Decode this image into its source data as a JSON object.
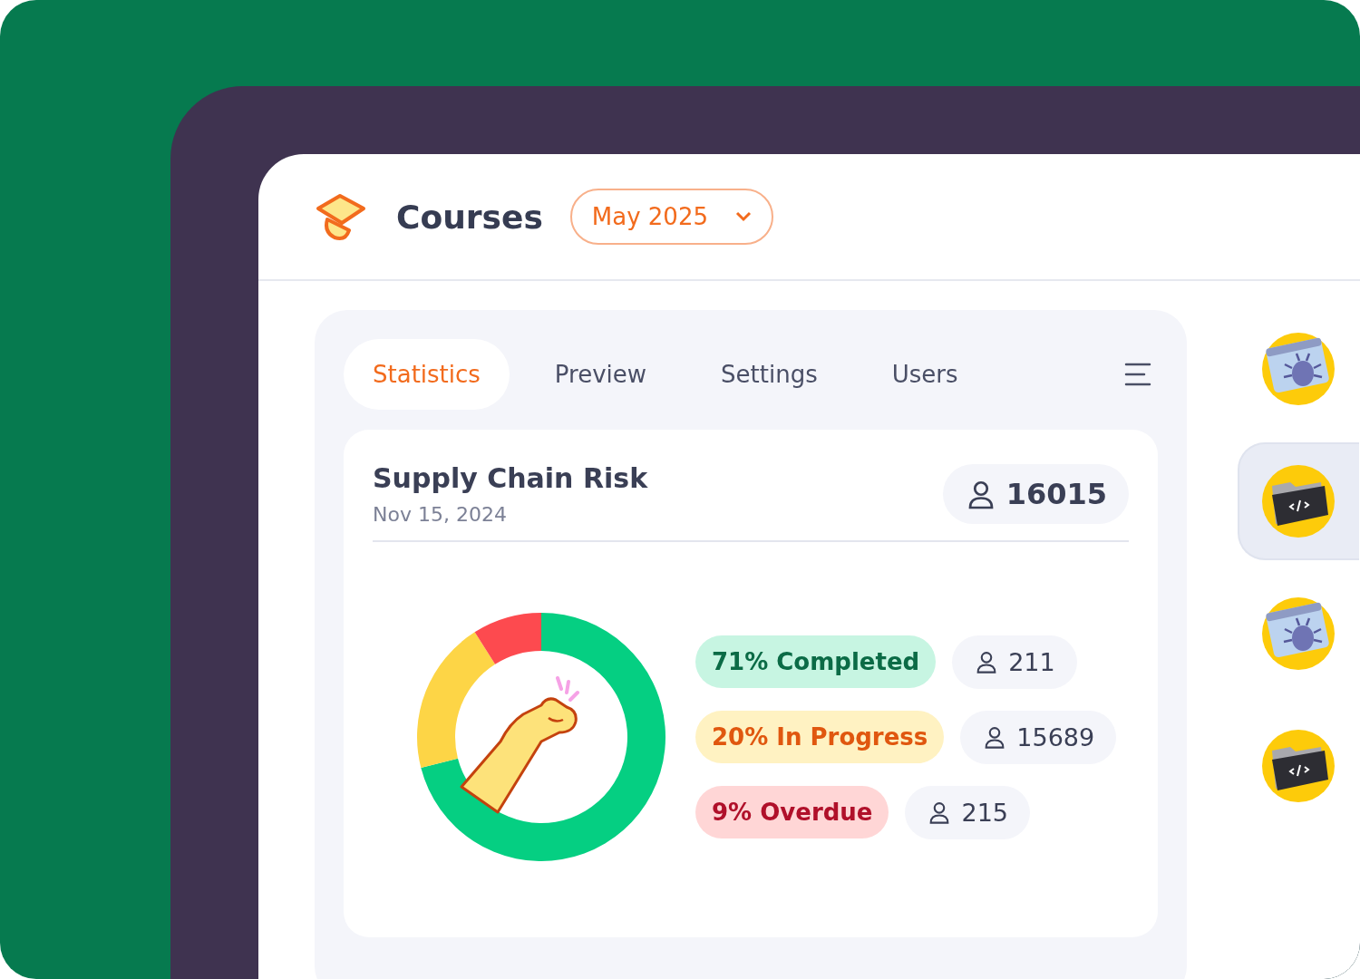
{
  "header": {
    "title": "Courses",
    "month_picker": {
      "value": "May 2025"
    }
  },
  "tabs": [
    {
      "label": "Statistics",
      "selected": true
    },
    {
      "label": "Preview",
      "selected": false
    },
    {
      "label": "Settings",
      "selected": false
    },
    {
      "label": "Users",
      "selected": false
    }
  ],
  "course_card": {
    "title": "Supply Chain Risk",
    "date": "Nov 15, 2024",
    "participants": "16015",
    "chart_data": {
      "type": "donut",
      "categories": [
        "71% Completed",
        "20% In Progress",
        "9% Overdue"
      ],
      "values": [
        71,
        20,
        9
      ]
    },
    "legend": [
      {
        "count": "211",
        "color": "#05cf82"
      },
      {
        "count": "15689",
        "color": "#fdd546"
      },
      {
        "count": "215",
        "color": "#fd4a4f"
      }
    ]
  },
  "side_list": [
    {
      "kind": "bug",
      "selected": false
    },
    {
      "kind": "code",
      "selected": true
    },
    {
      "kind": "bug",
      "selected": false
    },
    {
      "kind": "code",
      "selected": false
    }
  ]
}
